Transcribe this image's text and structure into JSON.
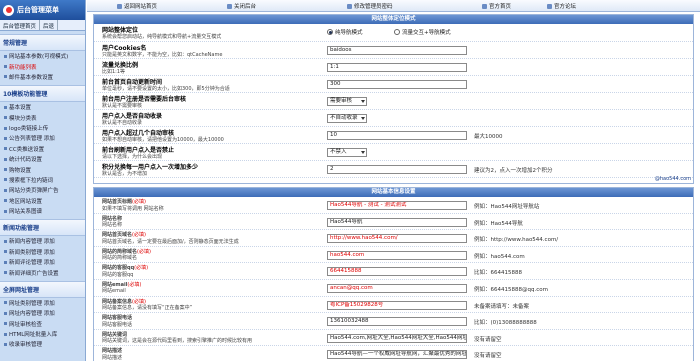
{
  "app": {
    "title": "后台管理菜单"
  },
  "sidebar": {
    "nav": [
      {
        "label": "后台管理首页"
      },
      {
        "label": "后退"
      }
    ],
    "groups": [
      {
        "title": "常规管理",
        "items": [
          {
            "label": "网站基本参数(可视模式)",
            "red": false
          },
          {
            "label": "新功能列表",
            "red": true
          },
          {
            "label": "邮件基本参数设置",
            "red": false
          }
        ]
      },
      {
        "title": "10模板功能管理",
        "items": [
          {
            "label": "基本设置",
            "red": false
          },
          {
            "label": "模块分类表",
            "red": false
          },
          {
            "label": "logo类链接上传",
            "red": false
          },
          {
            "label": "公告列表管理 添加",
            "red": false
          },
          {
            "label": "CC类推送设置",
            "red": false
          },
          {
            "label": "统计代码设置",
            "red": false
          },
          {
            "label": "购物设置",
            "red": false
          },
          {
            "label": "搜索框下拉内链词",
            "red": false
          },
          {
            "label": "网站分类页弹屏广告",
            "red": false
          },
          {
            "label": "地区网站设置",
            "red": false
          },
          {
            "label": "网站关系图谱",
            "red": false
          }
        ]
      },
      {
        "title": "新闻功能管理",
        "items": [
          {
            "label": "新闻内容管理 添加",
            "red": false
          },
          {
            "label": "新闻类别管理 添加",
            "red": false
          },
          {
            "label": "新闻评论管理 添加",
            "red": false
          },
          {
            "label": "新闻详细页广告设置",
            "red": false
          }
        ]
      },
      {
        "title": "全屏网址管理",
        "items": [
          {
            "label": "网址类别管理 添加",
            "red": false
          },
          {
            "label": "网址内容管理 添加",
            "red": false
          },
          {
            "label": "网址审核检查",
            "red": false
          },
          {
            "label": "HTML网址批量入库",
            "red": false
          },
          {
            "label": "收录审核管理",
            "red": false
          }
        ]
      }
    ]
  },
  "topbar": {
    "links": [
      {
        "label": "返回网站首页"
      },
      {
        "label": "关闭后台"
      },
      {
        "label": "修改管理员密码"
      },
      {
        "label": "官方首页"
      },
      {
        "label": "官方论坛"
      }
    ]
  },
  "panel1": {
    "title": "网站整体定位模式",
    "rows": [
      {
        "label": "网站整体定位",
        "desc": "系统会帮您启动站，纯导航模式和导航+流量交互模式",
        "radio1": "纯导航模式",
        "radio2": "流量交互+导航模式"
      },
      {
        "label": "用户Cookies名",
        "desc": "只能是英文和数字，不能为空，比如：qtCacheName",
        "value": "baidoos"
      },
      {
        "label": "流量兑换比例",
        "desc": "比如1:1等",
        "value": "1:1"
      },
      {
        "label": "前台首页自动更新时间",
        "desc": "单位毫秒，请不要设置的太小，比如300，即5分钟为合适",
        "value": "300"
      },
      {
        "label": "前台用户注册是否需要后台审核",
        "desc": "默认是不需要审核",
        "select": "需要审核"
      },
      {
        "label": "用户点入是否自动收录",
        "desc": "默认是不自动收录",
        "select": "不自动收录"
      },
      {
        "label": "用户点入超过几个自动审核",
        "desc": "如果不想自动审核，请把他设置为10000，最大10000",
        "value": "10",
        "note": "最大10000"
      },
      {
        "label": "前台刷新用户点入是否禁止",
        "desc": "请以下选择，为什么会出现",
        "select": "不禁入"
      },
      {
        "label": "积分兑换每一用户点入一次增加多少",
        "desc": "默认是否，为不增加",
        "value": "2",
        "note": "建议为2，点入一次增加2个积分"
      }
    ],
    "footlink": "@hao544.com"
  },
  "panel2": {
    "title": "网站基本信息设置",
    "req": "(必填)",
    "rows": [
      {
        "label": "网站首页标题",
        "desc": "如果不填写将调用 网站名称",
        "value": "Hao544导航 - 测试 - 测试测试",
        "red": true,
        "note": "例如：Hao544网址导航站"
      },
      {
        "label": "网站名称",
        "desc": "网站名称",
        "value": "Hao544导航",
        "red": false,
        "note": "例如：Hao544导航"
      },
      {
        "label": "网站首页域名",
        "desc": "网站首页域名，请一定要在最后面加/，否则静态页面无法生成",
        "value": "http://www.hao544.com/",
        "red": true,
        "note": "例如：http://www.hao544.com/"
      },
      {
        "label": "网站的简称域名",
        "desc": "网站的简称域名",
        "value": "hao544.com",
        "red": true,
        "note": "例如：hao544.com"
      },
      {
        "label": "网站的客服qq",
        "desc": "网站的客服qq",
        "value": "664415888",
        "red": true,
        "note": "比如：664415888"
      },
      {
        "label": "网站email",
        "desc": "网站email",
        "value": "ancan@qq.com",
        "red": true,
        "note": "例如：664415888@qq.com"
      },
      {
        "label": "网站备案信息",
        "desc": "网站备案信息，请没有填写“正在备案中”",
        "value": "粤ICP备15029828号",
        "red": true,
        "note": "未备案请填写：未备案"
      },
      {
        "label": "网站客服电话",
        "desc": "网站客服电话",
        "value": "13610032488",
        "red": false,
        "note": "比如：(0)13088888888"
      },
      {
        "label": "网站关键词",
        "desc": "网站关键词，这是会在源代码里看到，搜索引擎推广的时候比较有用",
        "value": "Hao544.com,网址大全,Hao544网址大全,Hao544网址导",
        "red": false,
        "note": "没有请留空"
      },
      {
        "label": "网站描述",
        "desc": "网站描述",
        "value": "Hao544导航—一个权威网址导航网，汇聚最优秀的网址！",
        "red": false,
        "note": "没有请留空"
      }
    ]
  }
}
